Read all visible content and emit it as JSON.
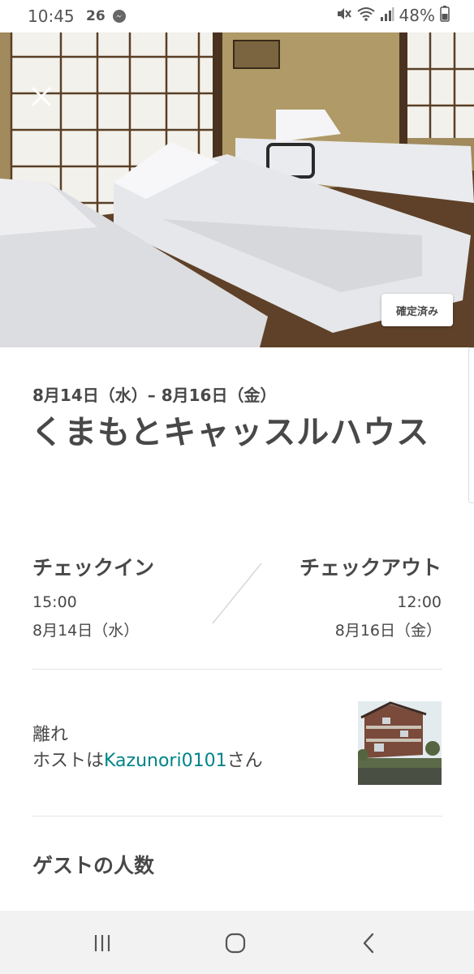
{
  "status_bar": {
    "time": "10:45",
    "temperature": "26",
    "battery": "48%"
  },
  "hero": {
    "status_badge": "確定済み"
  },
  "trip": {
    "date_range": "8月14日（水）– 8月16日（金）",
    "title": "くまもとキャッスルハウス"
  },
  "checkin": {
    "label": "チェックイン",
    "time": "15:00",
    "date": "8月14日（水）"
  },
  "checkout": {
    "label": "チェックアウト",
    "time": "12:00",
    "date": "8月16日（金）"
  },
  "host": {
    "room_type": "離れ",
    "prefix": "ホストは",
    "name": "Kazunori0101",
    "suffix": "さん"
  },
  "guests": {
    "title": "ゲストの人数"
  },
  "colors": {
    "link": "#008489",
    "text": "#484848"
  }
}
